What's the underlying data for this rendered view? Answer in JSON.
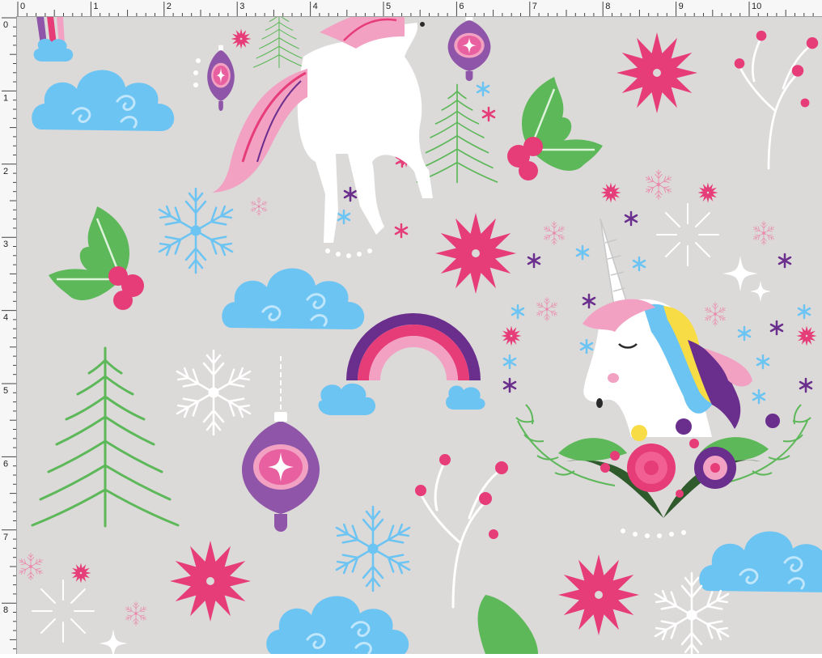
{
  "rulers": {
    "units": "inches",
    "top_labels": [
      "0",
      "1",
      "2",
      "3",
      "4",
      "5",
      "6",
      "7",
      "8",
      "9",
      "10"
    ],
    "left_labels": [
      "0",
      "1",
      "2",
      "3",
      "4",
      "5",
      "6",
      "7",
      "8"
    ]
  },
  "pattern": {
    "background": "#dcd9d9",
    "colors": {
      "pink": "#e63c78",
      "light_pink": "#f2a1c3",
      "sky_blue": "#6cc4f2",
      "green": "#5cb858",
      "dark_green": "#2f5a2c",
      "purple": "#8e55a8",
      "deep_purple": "#6a2e8c",
      "yellow": "#f8dc45",
      "white": "#ffffff"
    },
    "motifs": [
      "unicorn-full",
      "unicorn-head",
      "rainbow",
      "cloud",
      "snowflake",
      "burst-flower",
      "holly",
      "ornament",
      "pine-tree",
      "berry-branch",
      "sparkle",
      "rose"
    ]
  }
}
